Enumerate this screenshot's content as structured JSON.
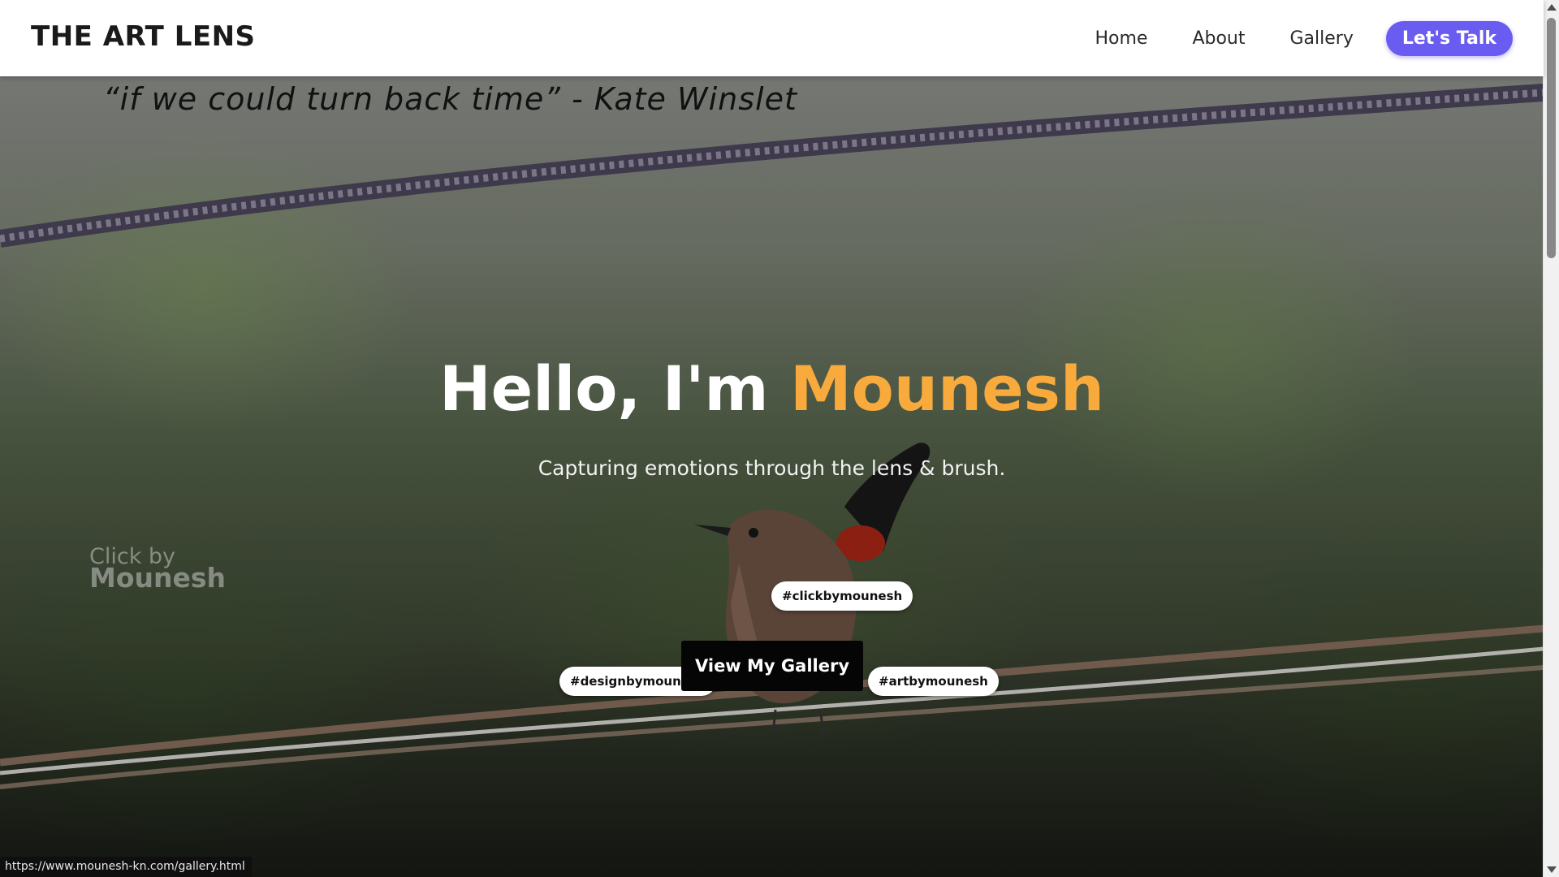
{
  "header": {
    "brand": "THE ART LENS",
    "nav": {
      "home": "Home",
      "about": "About",
      "gallery": "Gallery",
      "cta": "Let's Talk"
    }
  },
  "hero": {
    "quote": "“if we could turn back time” - Kate Winslet",
    "headline_prefix": "Hello, I'm ",
    "headline_name": "Mounesh",
    "tagline": "Capturing emotions through the lens & brush.",
    "watermark_line1": "Click by",
    "watermark_line2": "Mounesh",
    "tags": {
      "click": "#clickbymounesh",
      "design": "#designbymounesh",
      "art": "#artbymounesh"
    },
    "gallery_button": "View My Gallery"
  },
  "status_bar": {
    "url": "https://www.mounesh-kn.com/gallery.html"
  },
  "colors": {
    "accent_orange": "#f8aa3c",
    "cta_purple": "#6a5cf0",
    "header_bg": "#ffffff"
  },
  "icons": [
    "bird-photo",
    "scroll-up-arrow",
    "scroll-down-arrow"
  ]
}
